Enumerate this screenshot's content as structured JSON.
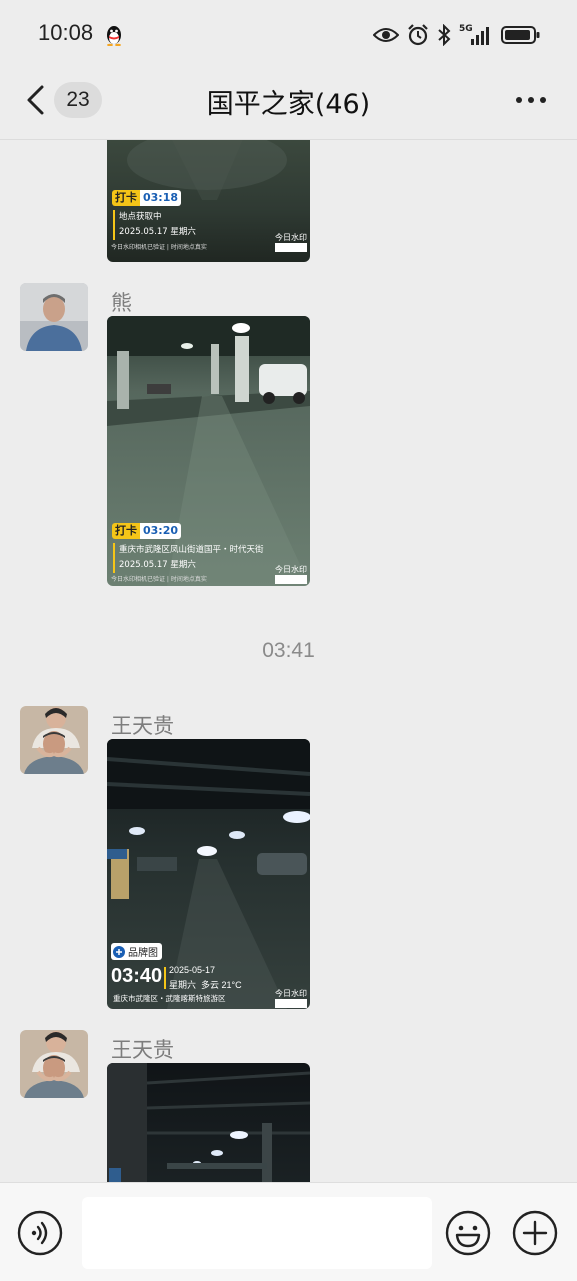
{
  "status_bar": {
    "time": "10:08",
    "network": "5G"
  },
  "header": {
    "unread_count": "23",
    "title": "国平之家(46)"
  },
  "messages": [
    {
      "type": "image",
      "sender": "",
      "watermark": {
        "label": "打卡",
        "time": "03:18",
        "location": "地点获取中",
        "date": "2025.05.17 星期六",
        "verify": "今日水印相机已验证 | 时间地点真实",
        "brand": "今日水印"
      }
    },
    {
      "type": "image",
      "sender": "熊",
      "watermark": {
        "label": "打卡",
        "time": "03:20",
        "location": "重庆市武隆区凤山街道国平・时代天街",
        "date": "2025.05.17 星期六",
        "verify": "今日水印相机已验证 | 时间地点真实",
        "brand": "今日水印"
      }
    },
    {
      "type": "timestamp",
      "text": "03:41"
    },
    {
      "type": "image",
      "sender": "王天贵",
      "watermark": {
        "label": "品牌图",
        "time": "03:40",
        "date": "2025-05-17",
        "weather": "星期六  多云 21°C",
        "location": "重庆市武隆区・武隆喀斯特旅游区",
        "brand": "今日水印"
      }
    },
    {
      "type": "image",
      "sender": "王天贵"
    }
  ],
  "colors": {
    "background": "#ededed",
    "input_bar": "#f7f7f7",
    "watermark_accent": "#f5c518"
  }
}
